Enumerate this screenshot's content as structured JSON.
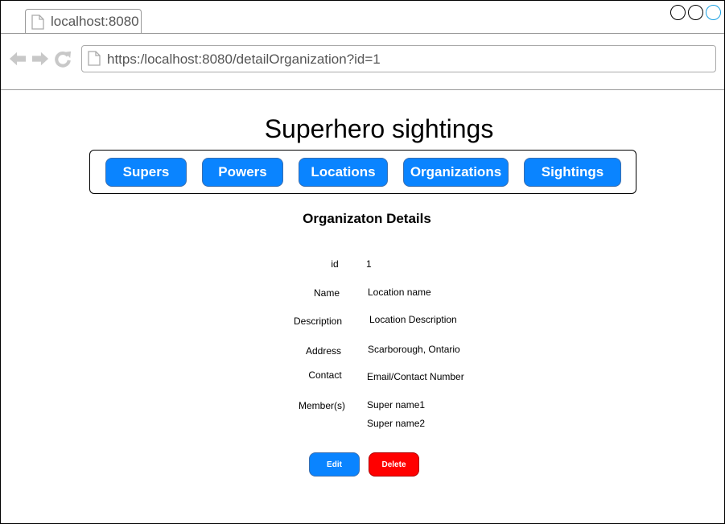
{
  "browser": {
    "tab_title": "localhost:8080",
    "url": "https:/localhost:8080/detailOrganization?id=1"
  },
  "page": {
    "title": "Superhero sightings",
    "nav": [
      "Supers",
      "Powers",
      "Locations",
      "Organizations",
      "Sightings"
    ],
    "section_title": "Organizaton Details"
  },
  "details": {
    "id_label": "id",
    "id_value": "1",
    "name_label": "Name",
    "name_value": "Location name",
    "description_label": "Description",
    "description_value": "Location Description",
    "address_label": "Address",
    "address_value": "Scarborough, Ontario",
    "contact_label": "Contact",
    "contact_value": "Email/Contact  Number",
    "members_label": "Member(s)",
    "members": [
      "Super name1",
      "Super name2"
    ]
  },
  "actions": {
    "edit_label": "Edit",
    "delete_label": "Delete"
  },
  "colors": {
    "primary": "#0a84ff",
    "danger": "#ff0000"
  }
}
